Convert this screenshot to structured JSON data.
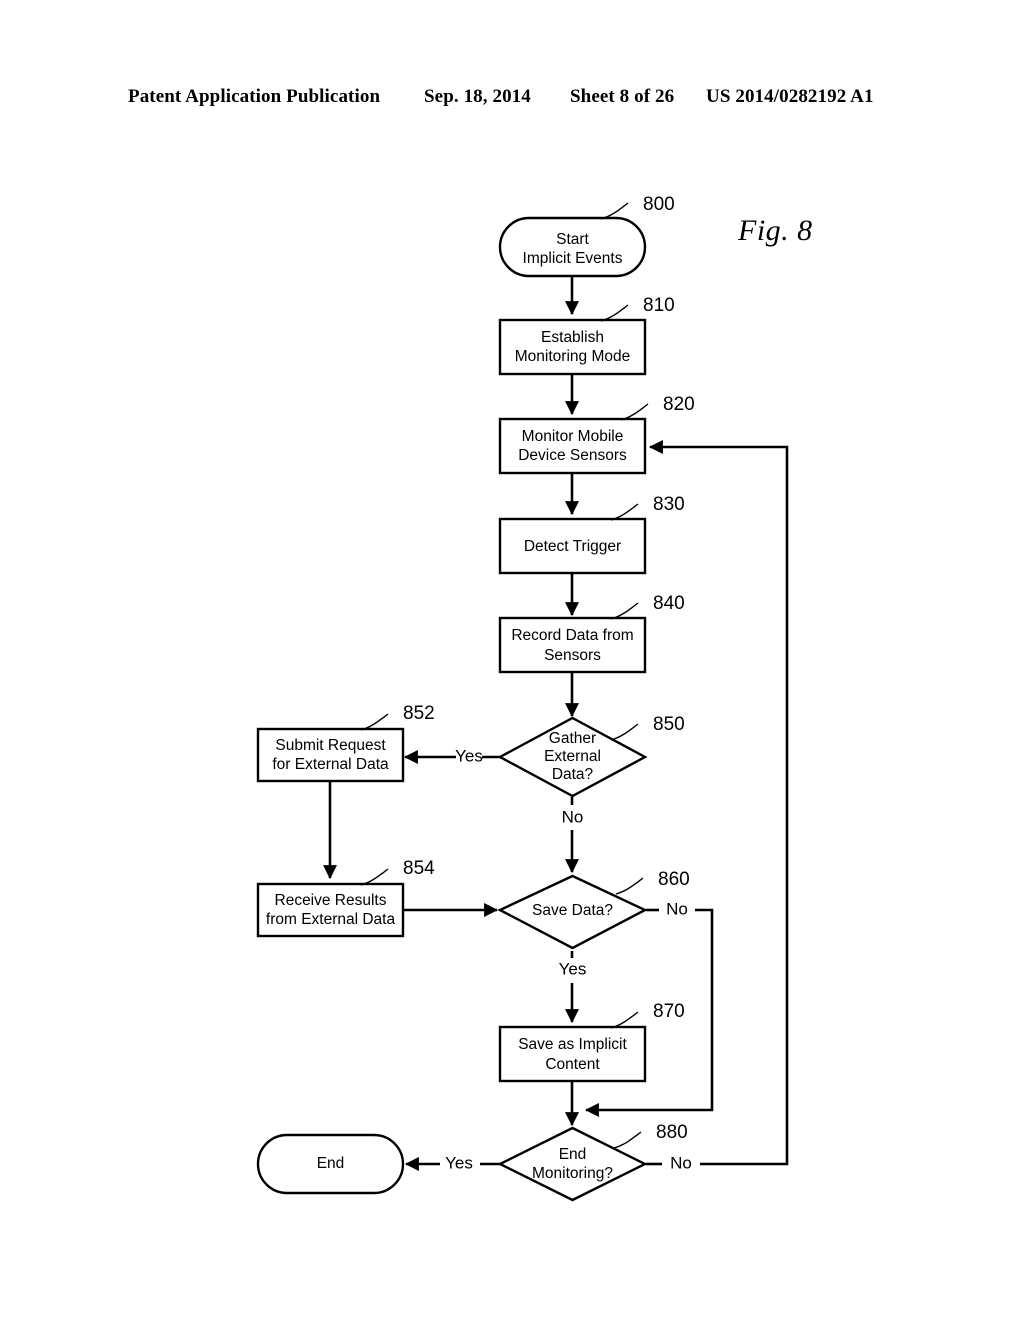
{
  "header": {
    "publication": "Patent Application Publication",
    "date": "Sep. 18, 2014",
    "sheet": "Sheet 8 of 26",
    "patent_number": "US 2014/0282192 A1"
  },
  "figure": {
    "label": "Fig. 8"
  },
  "flowchart": {
    "nodes": [
      {
        "id": "800",
        "ref": "800",
        "shape": "terminator",
        "lines": [
          "Start",
          "Implicit Events"
        ]
      },
      {
        "id": "810",
        "ref": "810",
        "shape": "process",
        "lines": [
          "Establish",
          "Monitoring Mode"
        ]
      },
      {
        "id": "820",
        "ref": "820",
        "shape": "process",
        "lines": [
          "Monitor Mobile",
          "Device Sensors"
        ]
      },
      {
        "id": "830",
        "ref": "830",
        "shape": "process",
        "lines": [
          "Detect Trigger"
        ]
      },
      {
        "id": "840",
        "ref": "840",
        "shape": "process",
        "lines": [
          "Record Data from",
          "Sensors"
        ]
      },
      {
        "id": "850",
        "ref": "850",
        "shape": "decision",
        "lines": [
          "Gather",
          "External",
          "Data?"
        ]
      },
      {
        "id": "852",
        "ref": "852",
        "shape": "process",
        "lines": [
          "Submit Request",
          "for External Data"
        ]
      },
      {
        "id": "854",
        "ref": "854",
        "shape": "process",
        "lines": [
          "Receive Results",
          "from External Data"
        ]
      },
      {
        "id": "860",
        "ref": "860",
        "shape": "decision",
        "lines": [
          "Save Data?"
        ]
      },
      {
        "id": "870",
        "ref": "870",
        "shape": "process",
        "lines": [
          "Save as Implicit",
          "Content"
        ]
      },
      {
        "id": "880",
        "ref": "880",
        "shape": "decision",
        "lines": [
          "End",
          "Monitoring?"
        ]
      },
      {
        "id": "end",
        "ref": "",
        "shape": "terminator",
        "lines": [
          "End"
        ]
      }
    ],
    "edge_labels": {
      "gather_yes": "Yes",
      "gather_no": "No",
      "save_yes": "Yes",
      "save_no": "No",
      "end_yes": "Yes",
      "end_no": "No"
    },
    "node_text": {
      "n800_l1": "Start",
      "n800_l2": "Implicit Events",
      "n810_l1": "Establish",
      "n810_l2": "Monitoring Mode",
      "n820_l1": "Monitor Mobile",
      "n820_l2": "Device Sensors",
      "n830_l1": "Detect Trigger",
      "n840_l1": "Record Data from",
      "n840_l2": "Sensors",
      "n850_l1": "Gather",
      "n850_l2": "External",
      "n850_l3": "Data?",
      "n852_l1": "Submit Request",
      "n852_l2": "for External Data",
      "n854_l1": "Receive Results",
      "n854_l2": "from External Data",
      "n860_l1": "Save Data?",
      "n870_l1": "Save as Implicit",
      "n870_l2": "Content",
      "n880_l1": "End",
      "n880_l2": "Monitoring?",
      "nend_l1": "End"
    },
    "refs": {
      "r800": "800",
      "r810": "810",
      "r820": "820",
      "r830": "830",
      "r840": "840",
      "r850": "850",
      "r852": "852",
      "r854": "854",
      "r860": "860",
      "r870": "870",
      "r880": "880"
    }
  },
  "colors": {
    "ink": "#000000",
    "paper": "#ffffff"
  }
}
